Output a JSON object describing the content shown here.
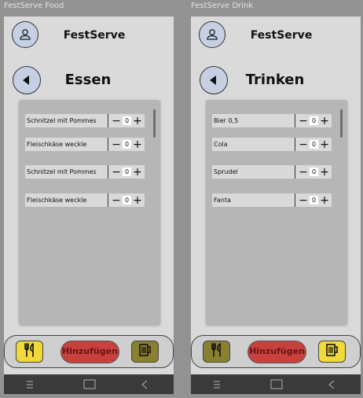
{
  "brand": "FestServe",
  "colors": {
    "background": "#929292",
    "screen": "#dadada",
    "accent_blue": "#c5d0e4",
    "add_button": "#c9413d",
    "tab_active": "#f2d93b",
    "tab_inactive": "#8a8030"
  },
  "food": {
    "frame_title": "FestServe Food",
    "page_title": "Essen",
    "add_label": "Hinzufügen",
    "active_tab": "food",
    "items": [
      {
        "name": "Schnitzel mit Pommes",
        "qty": "0",
        "minus": "−",
        "plus": "+"
      },
      {
        "name": "Fleischkäse weckle",
        "qty": "0",
        "minus": "−",
        "plus": "+"
      },
      {
        "name": "Schnitzel mit Pommes",
        "qty": "0",
        "minus": "−",
        "plus": "+"
      },
      {
        "name": "Fleischkäse weckle",
        "qty": "0",
        "minus": "−",
        "plus": "+"
      }
    ]
  },
  "drink": {
    "frame_title": "FestServe Drink",
    "page_title": "Trinken",
    "add_label": "Hinzufügen",
    "active_tab": "drink",
    "items": [
      {
        "name": "Bier 0,5",
        "qty": "0",
        "minus": "−",
        "plus": "+"
      },
      {
        "name": "Cola",
        "qty": "0",
        "minus": "−",
        "plus": "+"
      },
      {
        "name": "Sprudel",
        "qty": "0",
        "minus": "−",
        "plus": "+"
      },
      {
        "name": "Fanta",
        "qty": "0",
        "minus": "−",
        "plus": "+"
      }
    ]
  },
  "icons": {
    "avatar": "user-icon",
    "back": "arrow-left-icon",
    "food_tab": "fork-knife-icon",
    "drink_tab": "beer-mug-icon",
    "nav_menu": "menu-icon",
    "nav_home": "home-icon",
    "nav_back": "back-icon"
  }
}
